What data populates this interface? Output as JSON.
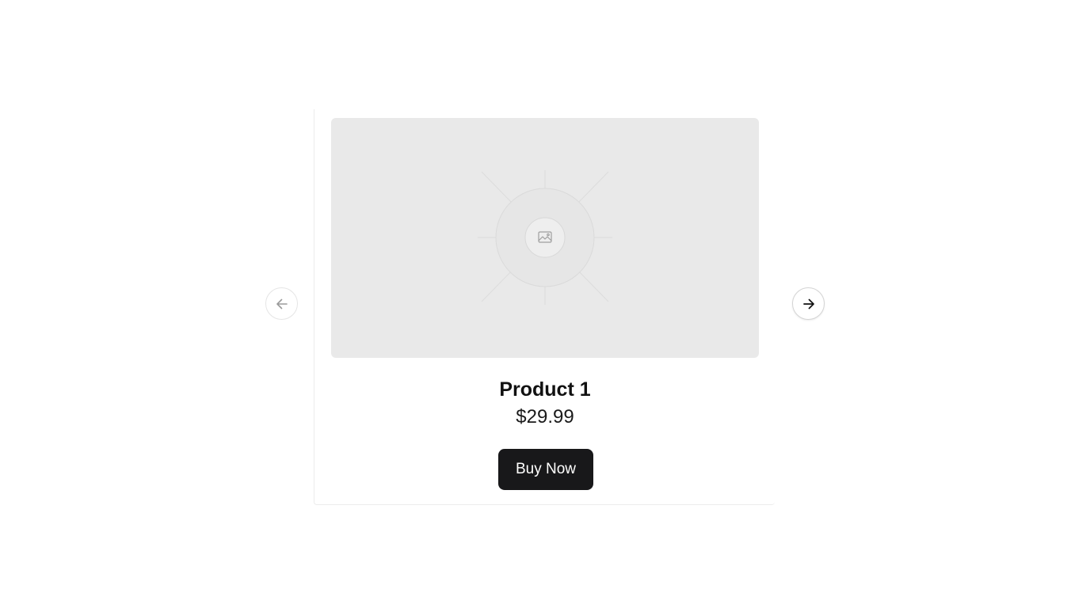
{
  "product": {
    "title": "Product 1",
    "price": "$29.99",
    "buy_label": "Buy Now",
    "image_icon": "image-placeholder-icon"
  },
  "carousel": {
    "prev_icon": "arrow-left-icon",
    "next_icon": "arrow-right-icon",
    "prev_enabled": false,
    "next_enabled": true
  },
  "colors": {
    "button_bg": "#18181a",
    "button_text": "#ffffff",
    "placeholder_bg": "#e9e9e9",
    "disabled_icon": "#9a9a9a",
    "enabled_icon": "#111111"
  }
}
